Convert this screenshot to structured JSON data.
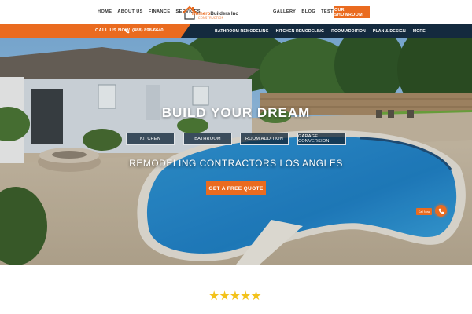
{
  "nav": {
    "left_links": [
      "HOME",
      "ABOUT US",
      "FINANCE",
      "SERVICES"
    ],
    "right_links": [
      "GALLERY",
      "BLOG",
      "TESTIMONIAL"
    ],
    "showroom_label": "OUR SHOWROOM"
  },
  "logo": {
    "name_main": "Romero",
    "name_rest": "Builders Inc",
    "tagline": "CONSTRUCTION"
  },
  "servicebar": {
    "call_label": "CALL US NOW",
    "phone": "(888) 898-6640",
    "services": [
      "BATHROOM REMODELING",
      "KITCHEN REMODELING",
      "ROOM ADDITION",
      "PLAN & DESIGN",
      "MORE"
    ]
  },
  "hero": {
    "title": "BUILD YOUR DREAM",
    "categories": [
      "KITCHEN",
      "BATHROOM",
      "ROOM ADDITION",
      "GARAGE CONVERSION"
    ],
    "subtitle": "REMODELING CONTRACTORS LOS ANGLES",
    "cta_label": "GET A FREE QUOTE",
    "call_now_label": "Call Now"
  },
  "rating": {
    "stars": "★★★★★",
    "value": 5
  },
  "colors": {
    "accent": "#ea6b1f",
    "navy": "#142a3e",
    "star": "#f3c21b"
  },
  "icons": [
    "phone-icon",
    "house-logo-icon",
    "star-icon"
  ]
}
